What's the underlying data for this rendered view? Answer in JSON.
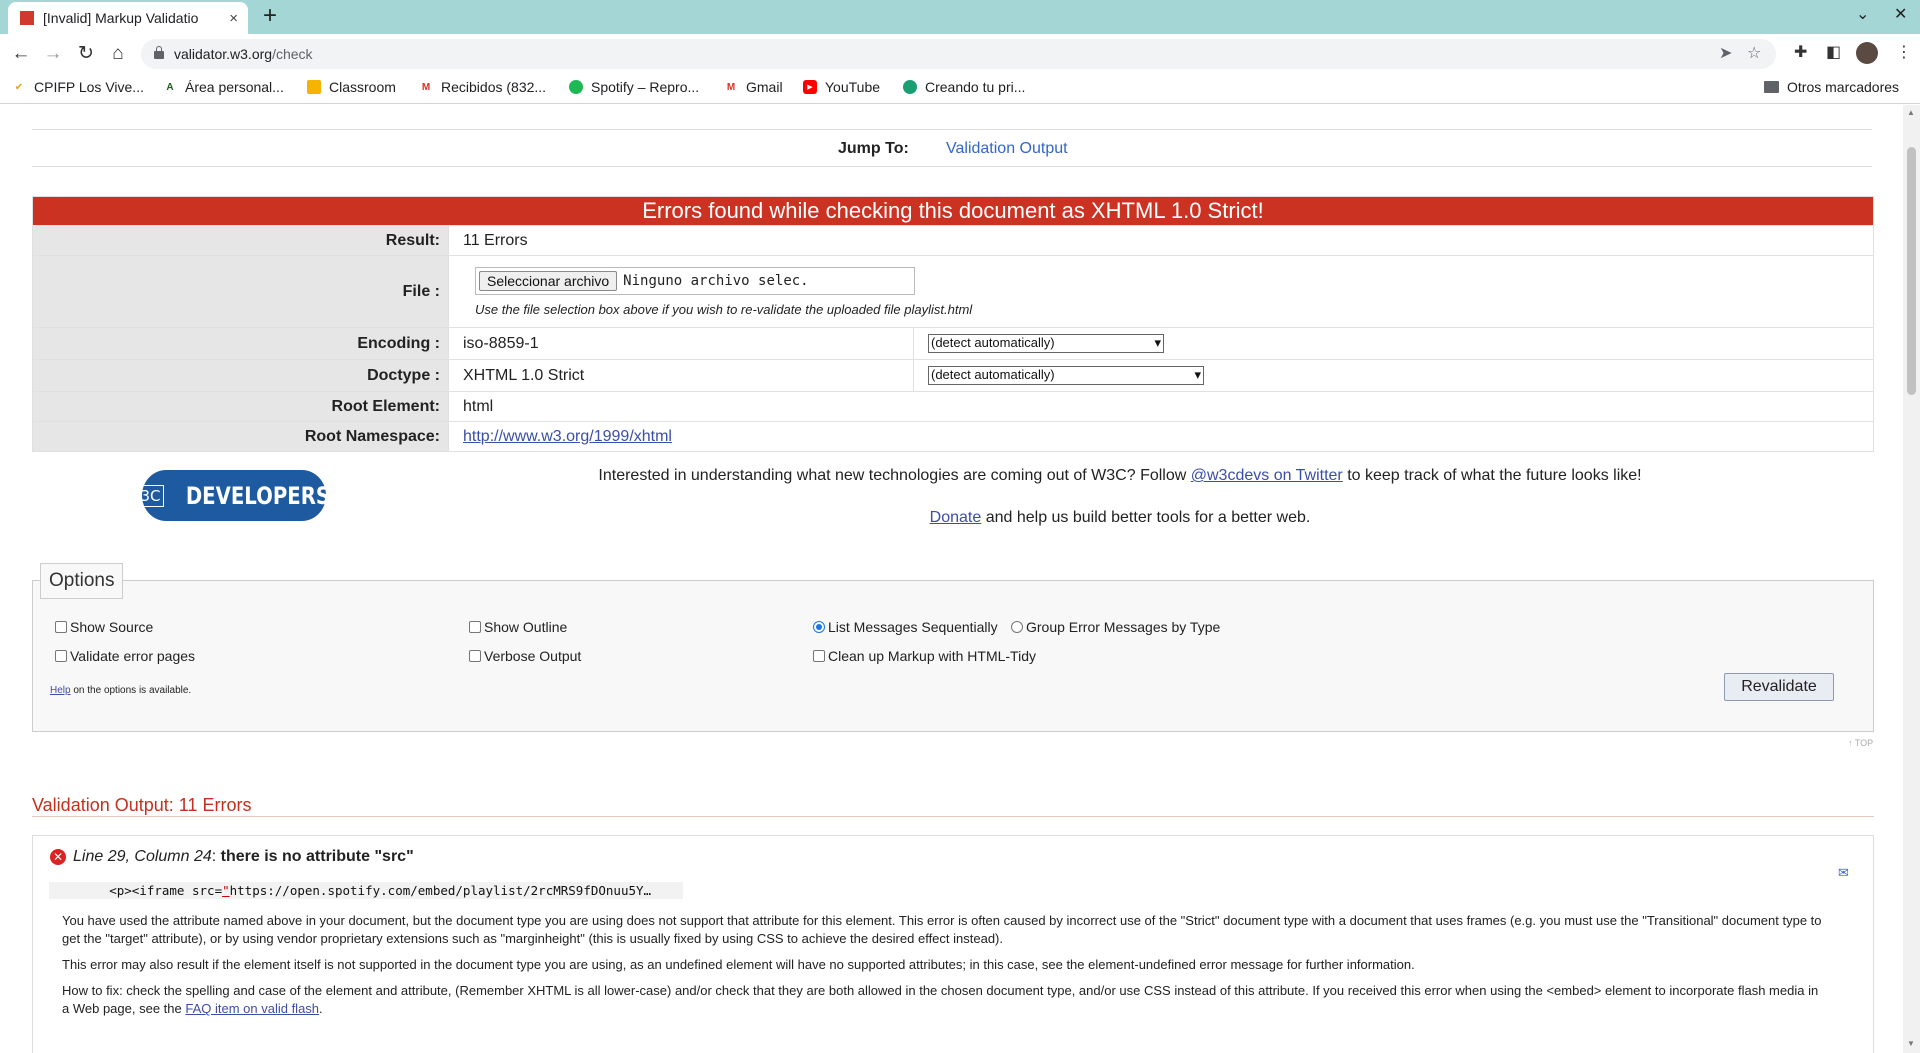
{
  "browser": {
    "tab_title": "[Invalid] Markup Validatio",
    "tab_close": "×",
    "new_tab": "+",
    "url_host": "validator.w3.org",
    "url_path": "/check",
    "bookmarks": [
      {
        "label": "CPIFP Los Vive...",
        "icon_color": "#e8a317"
      },
      {
        "label": "Área personal...",
        "icon_color": "#1b5e20"
      },
      {
        "label": "Classroom",
        "icon_color": "#f4b400"
      },
      {
        "label": "Recibidos (832...",
        "icon_color": "#d93025"
      },
      {
        "label": "Spotify – Repro...",
        "icon_color": "#1db954"
      },
      {
        "label": "Gmail",
        "icon_color": "#d93025"
      },
      {
        "label": "YouTube",
        "icon_color": "#ff0000"
      },
      {
        "label": "Creando tu pri...",
        "icon_color": "#1a9e73"
      }
    ],
    "other_bookmarks": "Otros marcadores"
  },
  "page": {
    "jump_to_label": "Jump To:",
    "jump_to_link": "Validation Output",
    "error_banner": "Errors found while checking this document as XHTML 1.0 Strict!",
    "rows": {
      "result_label": "Result:",
      "result_value": "11 Errors",
      "file_label": "File :",
      "file_button": "Seleccionar archivo",
      "file_none": "Ninguno archivo selec.",
      "file_help": "Use the file selection box above if you wish to re-validate the uploaded file playlist.html",
      "encoding_label": "Encoding :",
      "encoding_value": "iso-8859-1",
      "encoding_select": "(detect automatically)",
      "doctype_label": "Doctype :",
      "doctype_value": "XHTML 1.0 Strict",
      "doctype_select": "(detect automatically)",
      "root_element_label": "Root Element:",
      "root_element_value": "html",
      "root_ns_label": "Root Namespace:",
      "root_ns_value": "http://www.w3.org/1999/xhtml"
    },
    "w3c_logo": {
      "mark": "W3C",
      "word": "DEVELOPERS"
    },
    "promo": {
      "text_before": "Interested in understanding what new technologies are coming out of W3C? Follow ",
      "twitter_link": "@w3cdevs on Twitter",
      "text_after": " to keep track of what the future looks like!",
      "donate_link": "Donate",
      "donate_after": " and help us build better tools for a better web."
    },
    "options": {
      "legend": "Options",
      "show_source": "Show Source",
      "show_outline": "Show Outline",
      "list_sequential": "List Messages Sequentially",
      "group_by_type": "Group Error Messages by Type",
      "validate_error_pages": "Validate error pages",
      "verbose_output": "Verbose Output",
      "cleanup_tidy": "Clean up Markup with HTML-Tidy",
      "help_link": "Help",
      "help_after": " on the options is available.",
      "revalidate": "Revalidate"
    },
    "top_link": "↑ TOP",
    "validation_output_title": "Validation Output: 11 Errors",
    "message": {
      "location": "Line 29, Column 24",
      "separator": ": ",
      "title": "there is no attribute \"src\"",
      "code_before": "        <p><iframe src=",
      "code_mark": "\"",
      "code_after": "https://open.spotify.com/embed/playlist/2rcMRS9fDOnuu5Y…",
      "p1": "You have used the attribute named above in your document, but the document type you are using does not support that attribute for this element. This error is often caused by incorrect use of the \"Strict\" document type with a document that uses frames (e.g. you must use the \"Transitional\" document type to get the \"target\" attribute), or by using vendor proprietary extensions such as \"marginheight\" (this is usually fixed by using CSS to achieve the desired effect instead).",
      "p2": "This error may also result if the element itself is not supported in the document type you are using, as an undefined element will have no supported attributes; in this case, see the element-undefined error message for further information.",
      "p3_before": "How to fix: check the spelling and case of the element and attribute, (Remember XHTML is all lower-case) and/or check that they are both allowed in the chosen document type, and/or use CSS instead of this attribute. If you received this error when using the <embed> element to incorporate flash media in a Web page, see the ",
      "p3_link": "FAQ item on valid flash",
      "p3_after": "."
    }
  }
}
